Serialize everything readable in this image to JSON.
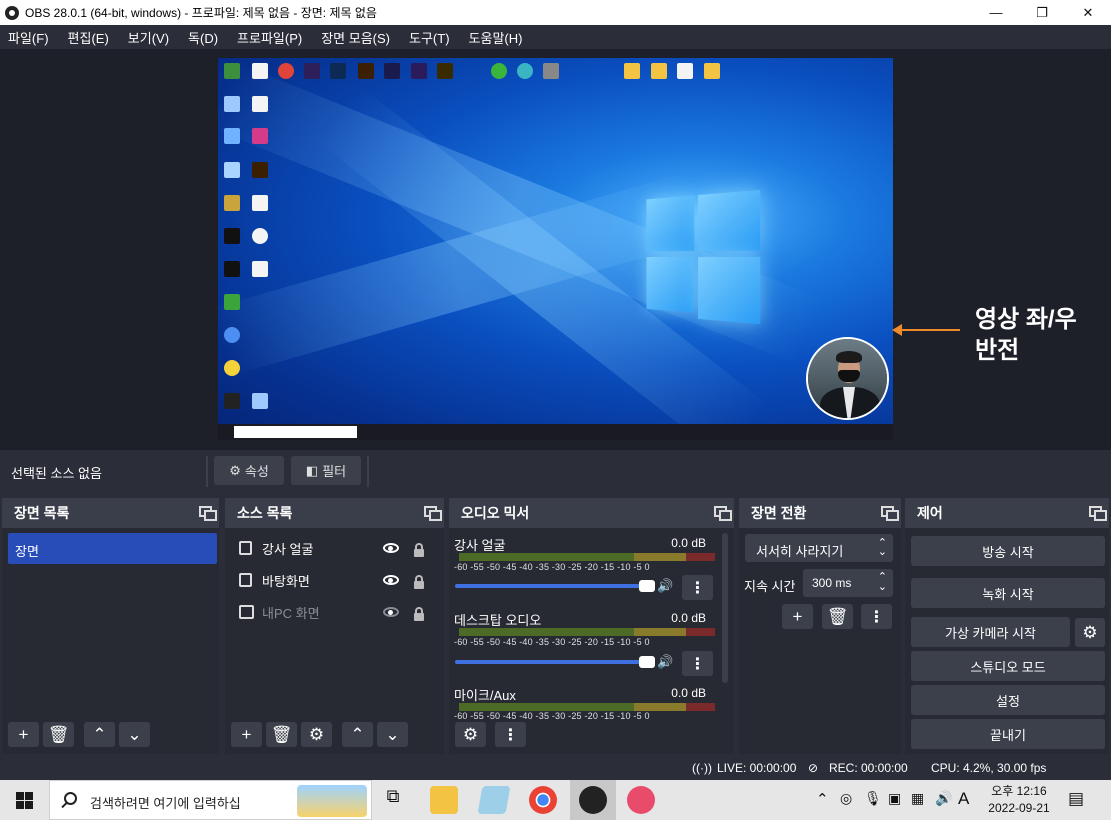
{
  "window": {
    "title": "OBS 28.0.1 (64-bit, windows) - 프로파일: 제목 없음 - 장면: 제목 없음",
    "minimize": "—",
    "maximize": "❐",
    "close": "✕"
  },
  "menu": [
    "파일(F)",
    "편집(E)",
    "보기(V)",
    "독(D)",
    "프로파일(P)",
    "장면 모음(S)",
    "도구(T)",
    "도움말(H)"
  ],
  "annotation": {
    "line1": "영상 좌/우",
    "line2": "반전",
    "arrow_color": "#f08a2a"
  },
  "context_bar": {
    "no_source": "선택된 소스 없음",
    "properties": "속성",
    "filters": "필터"
  },
  "scenes": {
    "title": "장면 목록",
    "items": [
      "장면"
    ]
  },
  "sources": {
    "title": "소스 목록",
    "items": [
      {
        "label": "강사 얼굴",
        "visible": true
      },
      {
        "label": "바탕화면",
        "visible": true
      },
      {
        "label": "내PC 화면",
        "visible": false
      }
    ]
  },
  "mixer": {
    "title": "오디오 믹서",
    "scale": "-60 -55 -50 -45 -40 -35 -30 -25 -20 -15 -10 -5 0",
    "channels": [
      {
        "name": "강사 얼굴",
        "db": "0.0 dB"
      },
      {
        "name": "데스크탑 오디오",
        "db": "0.0 dB"
      },
      {
        "name": "마이크/Aux",
        "db": "0.0 dB"
      }
    ]
  },
  "transitions": {
    "title": "장면 전환",
    "type": "서서히 사라지기",
    "duration_label": "지속 시간",
    "duration_value": "300 ms"
  },
  "controls": {
    "title": "제어",
    "start_stream": "방송 시작",
    "start_record": "녹화 시작",
    "virtual_camera": "가상 카메라 시작",
    "studio_mode": "스튜디오 모드",
    "settings": "설정",
    "exit": "끝내기"
  },
  "status": {
    "live": "LIVE: 00:00:00",
    "rec": "REC: 00:00:00",
    "cpu": "CPU: 4.2%, 30.00 fps"
  },
  "taskbar": {
    "search_placeholder": "검색하려면 여기에 입력하십",
    "ime": "A",
    "time": "오후 12:16",
    "date": "2022-09-21"
  },
  "colors": {
    "accent": "#284cb8",
    "panel_header": "#3a3e4a",
    "panel_bg": "#272a33",
    "window_bg": "#2b2e38"
  }
}
